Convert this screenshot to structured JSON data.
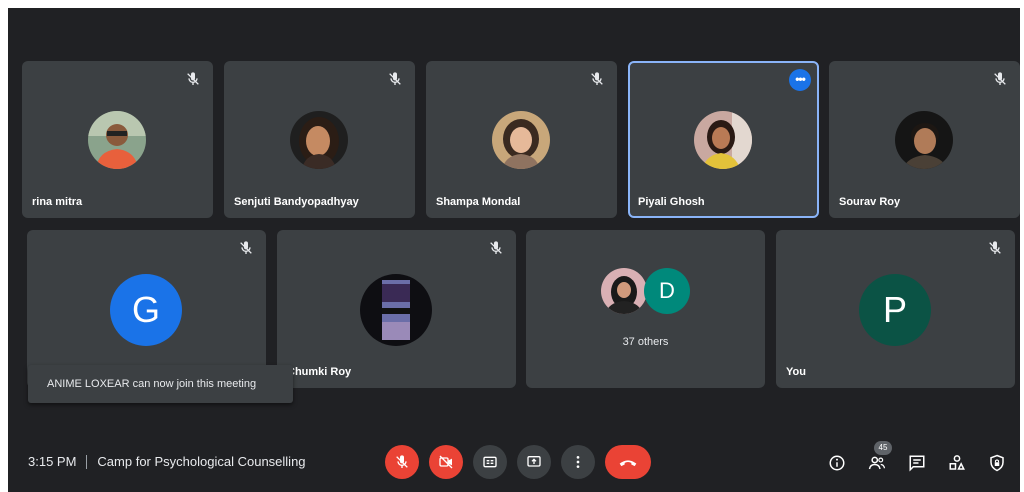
{
  "participants": [
    {
      "name": "rina mitra",
      "muted": true
    },
    {
      "name": "Senjuti Bandyopadhyay",
      "muted": true
    },
    {
      "name": "Shampa Mondal",
      "muted": true
    },
    {
      "name": "Piyali Ghosh",
      "muted": false,
      "active": true
    },
    {
      "name": "Sourav Roy",
      "muted": true
    },
    {
      "name": "",
      "avatar_letter": "G",
      "avatar_color": "#1a73e8",
      "muted": true
    },
    {
      "name": "Chumki Roy",
      "muted": true
    },
    {
      "name": "37 others",
      "avatar_letter": "D",
      "avatar_color": "#00897b"
    },
    {
      "name": "You",
      "avatar_letter": "P",
      "avatar_color": "#0b5345",
      "muted": true
    }
  ],
  "toast": {
    "text": "ANIME LOXEAR can now join this meeting"
  },
  "meeting": {
    "time": "3:15 PM",
    "title": "Camp for Psychological Counselling"
  },
  "people_count": "45",
  "colors": {
    "background": "#202124",
    "tile": "#3c4043",
    "accent": "#1a73e8",
    "danger": "#ea4335",
    "highlight": "#8ab4f8"
  },
  "icons": [
    "mic-off-icon",
    "camera-off-icon",
    "captions-icon",
    "present-screen-icon",
    "more-options-icon",
    "end-call-icon",
    "info-icon",
    "people-icon",
    "chat-icon",
    "activities-icon",
    "host-controls-icon"
  ]
}
